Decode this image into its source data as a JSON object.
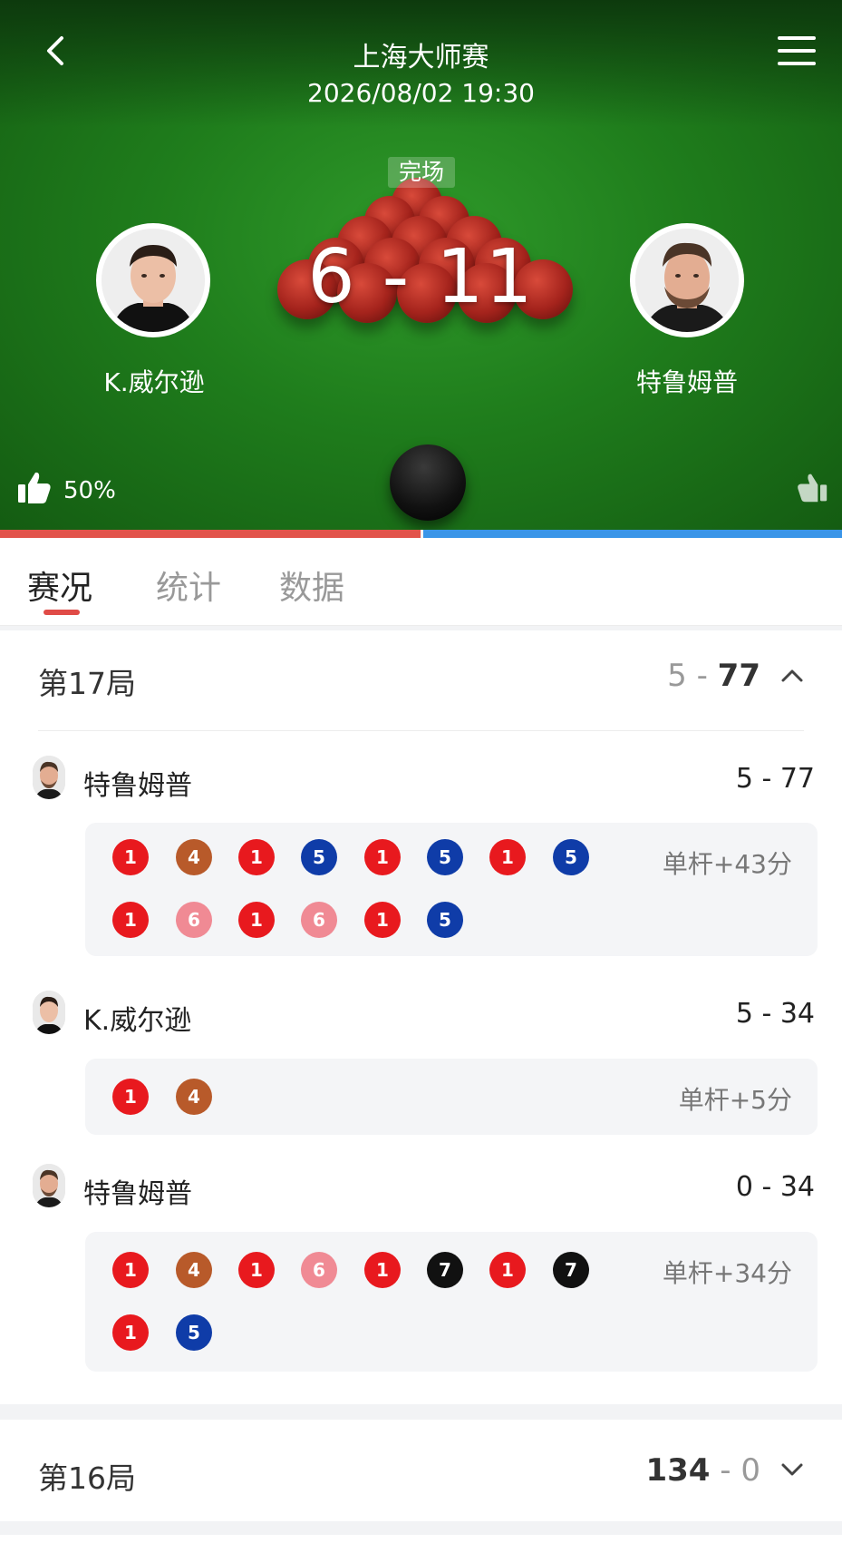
{
  "header": {
    "title": "上海大师赛",
    "datetime": "2026/08/02 19:30",
    "status": "完场",
    "score": "6 - 11"
  },
  "players": {
    "left": {
      "name": "K.威尔逊"
    },
    "right": {
      "name": "特鲁姆普"
    }
  },
  "vote": {
    "left_pct": "50%",
    "left_share": 0.5
  },
  "tabs": [
    {
      "label": "赛况",
      "active": true
    },
    {
      "label": "统计",
      "active": false
    },
    {
      "label": "数据",
      "active": false
    }
  ],
  "frames": [
    {
      "title": "第17局",
      "score_left": "5",
      "score_sep": " - ",
      "score_right": "77",
      "expanded": true,
      "breaks": [
        {
          "player": "特鲁姆普",
          "score": "5 - 77",
          "points_label": "单杆+43分",
          "balls": [
            [
              "1",
              "red"
            ],
            [
              "4",
              "brown"
            ],
            [
              "1",
              "red"
            ],
            [
              "5",
              "blue"
            ],
            [
              "1",
              "red"
            ],
            [
              "5",
              "blue"
            ],
            [
              "1",
              "red"
            ],
            [
              "5",
              "blue"
            ],
            [
              "1",
              "red"
            ],
            [
              "6",
              "pink"
            ],
            [
              "1",
              "red"
            ],
            [
              "6",
              "pink"
            ],
            [
              "1",
              "red"
            ],
            [
              "5",
              "blue"
            ]
          ]
        },
        {
          "player": "K.威尔逊",
          "score": "5 - 34",
          "points_label": "单杆+5分",
          "balls": [
            [
              "1",
              "red"
            ],
            [
              "4",
              "brown"
            ]
          ]
        },
        {
          "player": "特鲁姆普",
          "score": "0 - 34",
          "points_label": "单杆+34分",
          "balls": [
            [
              "1",
              "red"
            ],
            [
              "4",
              "brown"
            ],
            [
              "1",
              "red"
            ],
            [
              "6",
              "pink"
            ],
            [
              "1",
              "red"
            ],
            [
              "7",
              "black"
            ],
            [
              "1",
              "red"
            ],
            [
              "7",
              "black"
            ],
            [
              "1",
              "red"
            ],
            [
              "5",
              "blue"
            ]
          ]
        }
      ]
    },
    {
      "title": "第16局",
      "score_left": "134",
      "score_sep": " - ",
      "score_right": "0",
      "expanded": false
    }
  ]
}
